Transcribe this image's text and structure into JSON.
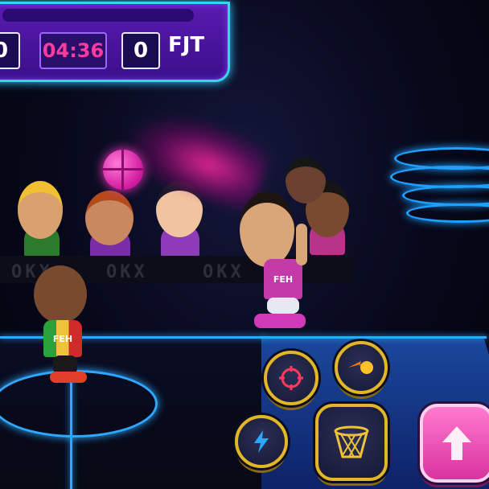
{
  "scoreboard": {
    "home_score": "0",
    "timer": "04:36",
    "away_score": "0",
    "away_team": "FJT"
  },
  "crowd": {
    "sponsor_text_1": "OKX",
    "sponsor_text_2": "OKX",
    "sponsor_text_3": "OKX"
  },
  "players": {
    "player_left_jersey": "FEH",
    "player_right_jersey": "FEH"
  },
  "controls": {
    "aim_icon": "target-icon",
    "shoot_fireball_icon": "fireball-icon",
    "boost_icon": "lightning-icon",
    "dunk_icon": "basketball-hoop-icon",
    "jump_icon": "up-arrow-icon"
  },
  "colors": {
    "accent_pink": "#ff3c9e",
    "neon_blue": "#2fa8ff",
    "scoreboard_purple": "#4a15a0",
    "button_gold": "#e3b62a"
  }
}
